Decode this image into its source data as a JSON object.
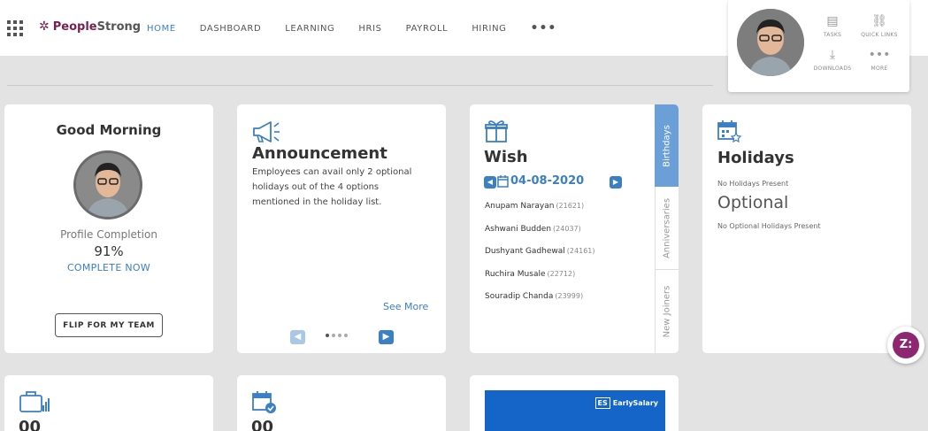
{
  "brand": {
    "name_part1": "People",
    "name_part2": "Strong"
  },
  "nav": {
    "items": [
      {
        "label": "HOME",
        "active": true
      },
      {
        "label": "DASHBOARD",
        "active": false
      },
      {
        "label": "LEARNING",
        "active": false
      },
      {
        "label": "HRIS",
        "active": false
      },
      {
        "label": "PAYROLL",
        "active": false
      },
      {
        "label": "HIRING",
        "active": false
      }
    ],
    "more": "•••"
  },
  "profile_menu": {
    "tasks": "TASKS",
    "quick_links": "QUICK LINKS",
    "downloads": "DOWNLOADS",
    "more": "MORE"
  },
  "greeting_card": {
    "title": "Good Morning",
    "profile_completion_label": "Profile Completion",
    "profile_completion_value": "91%",
    "complete_link": "COMPLETE NOW",
    "flip_button": "FLIP FOR MY TEAM"
  },
  "announcement_card": {
    "title": "Announcement",
    "body": "Employees can avail only 2 optional holidays out of the 4 options mentioned in the holiday list.",
    "see_more": "See More",
    "page_count": 4,
    "current_page": 1
  },
  "wish_card": {
    "title": "Wish",
    "date": "04-08-2020",
    "people": [
      {
        "name": "Anupam Narayan",
        "code": "(21621)"
      },
      {
        "name": "Ashwani Budden",
        "code": "(24037)"
      },
      {
        "name": "Dushyant Gadhewal",
        "code": "(24161)"
      },
      {
        "name": "Ruchira Musale",
        "code": "(22712)"
      },
      {
        "name": "Souradip Chanda",
        "code": "(23999)"
      }
    ],
    "tabs": [
      "Birthdays",
      "Anniversaries",
      "New Joiners"
    ]
  },
  "holidays_card": {
    "title": "Holidays",
    "no_holidays": "No Holidays Present",
    "optional_title": "Optional",
    "no_optional": "No Optional Holidays Present"
  },
  "bottom_cards": {
    "card1_value": "00",
    "card2_value": "00",
    "promo_brand": "EarlySalary",
    "promo_badge": "ES"
  },
  "chat": {
    "label": "Z:"
  },
  "colors": {
    "accent": "#3b7fc4",
    "brand": "#7a1f4f",
    "chat": "#8e2670",
    "background": "#e3e3e3"
  }
}
